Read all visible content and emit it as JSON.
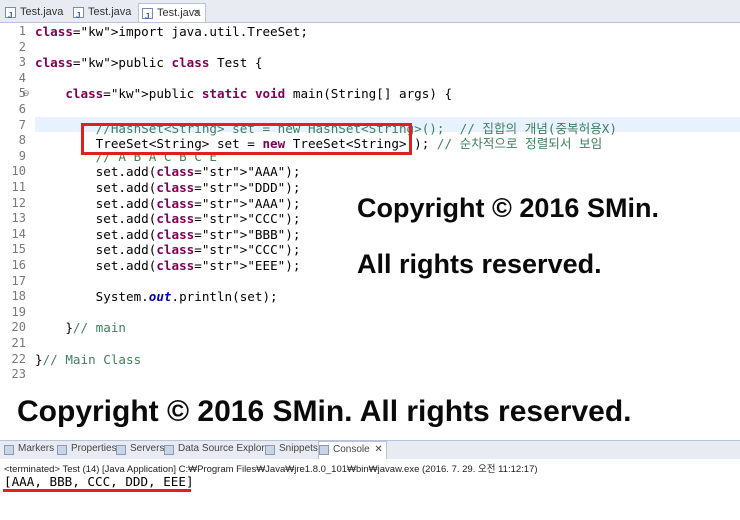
{
  "editor_tabs": [
    {
      "label": "Test.java",
      "active": false
    },
    {
      "label": "Test.java",
      "active": false
    },
    {
      "label": "Test.java",
      "active": true,
      "close": "✕"
    }
  ],
  "code_lines": [
    {
      "num": "1",
      "text": "import java.util.TreeSet;"
    },
    {
      "num": "2",
      "text": ""
    },
    {
      "num": "3",
      "text": "public class Test {"
    },
    {
      "num": "4",
      "text": ""
    },
    {
      "num": "5",
      "text": "    public static void main(String[] args) {"
    },
    {
      "num": "6",
      "text": ""
    },
    {
      "num": "7",
      "text": "        //HashSet<String> set = new HashSet<String>();  // 집합의 개념(중복허용X)"
    },
    {
      "num": "8",
      "text": "        TreeSet<String> set = new TreeSet<String>(); // 순차적으로 정렬되서 보임"
    },
    {
      "num": "9",
      "text": "        // A B A C B C E"
    },
    {
      "num": "10",
      "text": "        set.add(\"AAA\");"
    },
    {
      "num": "11",
      "text": "        set.add(\"DDD\");"
    },
    {
      "num": "12",
      "text": "        set.add(\"AAA\");"
    },
    {
      "num": "13",
      "text": "        set.add(\"CCC\");"
    },
    {
      "num": "14",
      "text": "        set.add(\"BBB\");"
    },
    {
      "num": "15",
      "text": "        set.add(\"CCC\");"
    },
    {
      "num": "16",
      "text": "        set.add(\"EEE\");"
    },
    {
      "num": "17",
      "text": ""
    },
    {
      "num": "18",
      "text": "        System.out.println(set);"
    },
    {
      "num": "19",
      "text": ""
    },
    {
      "num": "20",
      "text": "    }// main"
    },
    {
      "num": "21",
      "text": ""
    },
    {
      "num": "22",
      "text": "}// Main Class"
    },
    {
      "num": "23",
      "text": ""
    }
  ],
  "watermarks": {
    "line1": "Copyright © 2016 SMin.",
    "line2": "All rights reserved.",
    "line3": "Copyright © 2016 SMin. All rights reserved."
  },
  "bottom_panel": {
    "tabs": [
      {
        "label": "Markers",
        "icon": "markers-icon"
      },
      {
        "label": "Properties",
        "icon": "properties-icon"
      },
      {
        "label": "Servers",
        "icon": "servers-icon"
      },
      {
        "label": "Data Source Explorer",
        "icon": "data-source-icon"
      },
      {
        "label": "Snippets",
        "icon": "snippets-icon"
      },
      {
        "label": "Console",
        "icon": "console-icon",
        "active": true,
        "close": "✕"
      }
    ],
    "terminated_line": "<terminated> Test (14) [Java Application] C:₩Program Files₩Java₩jre1.8.0_101₩bin₩javaw.exe (2016. 7. 29. 오전 11:12:17)",
    "output": "[AAA, BBB, CCC, DDD, EEE]"
  },
  "colors": {
    "keyword": "#7f0055",
    "string": "#2a00ff",
    "comment": "#3f7f5f",
    "highlight": "#e02020"
  }
}
